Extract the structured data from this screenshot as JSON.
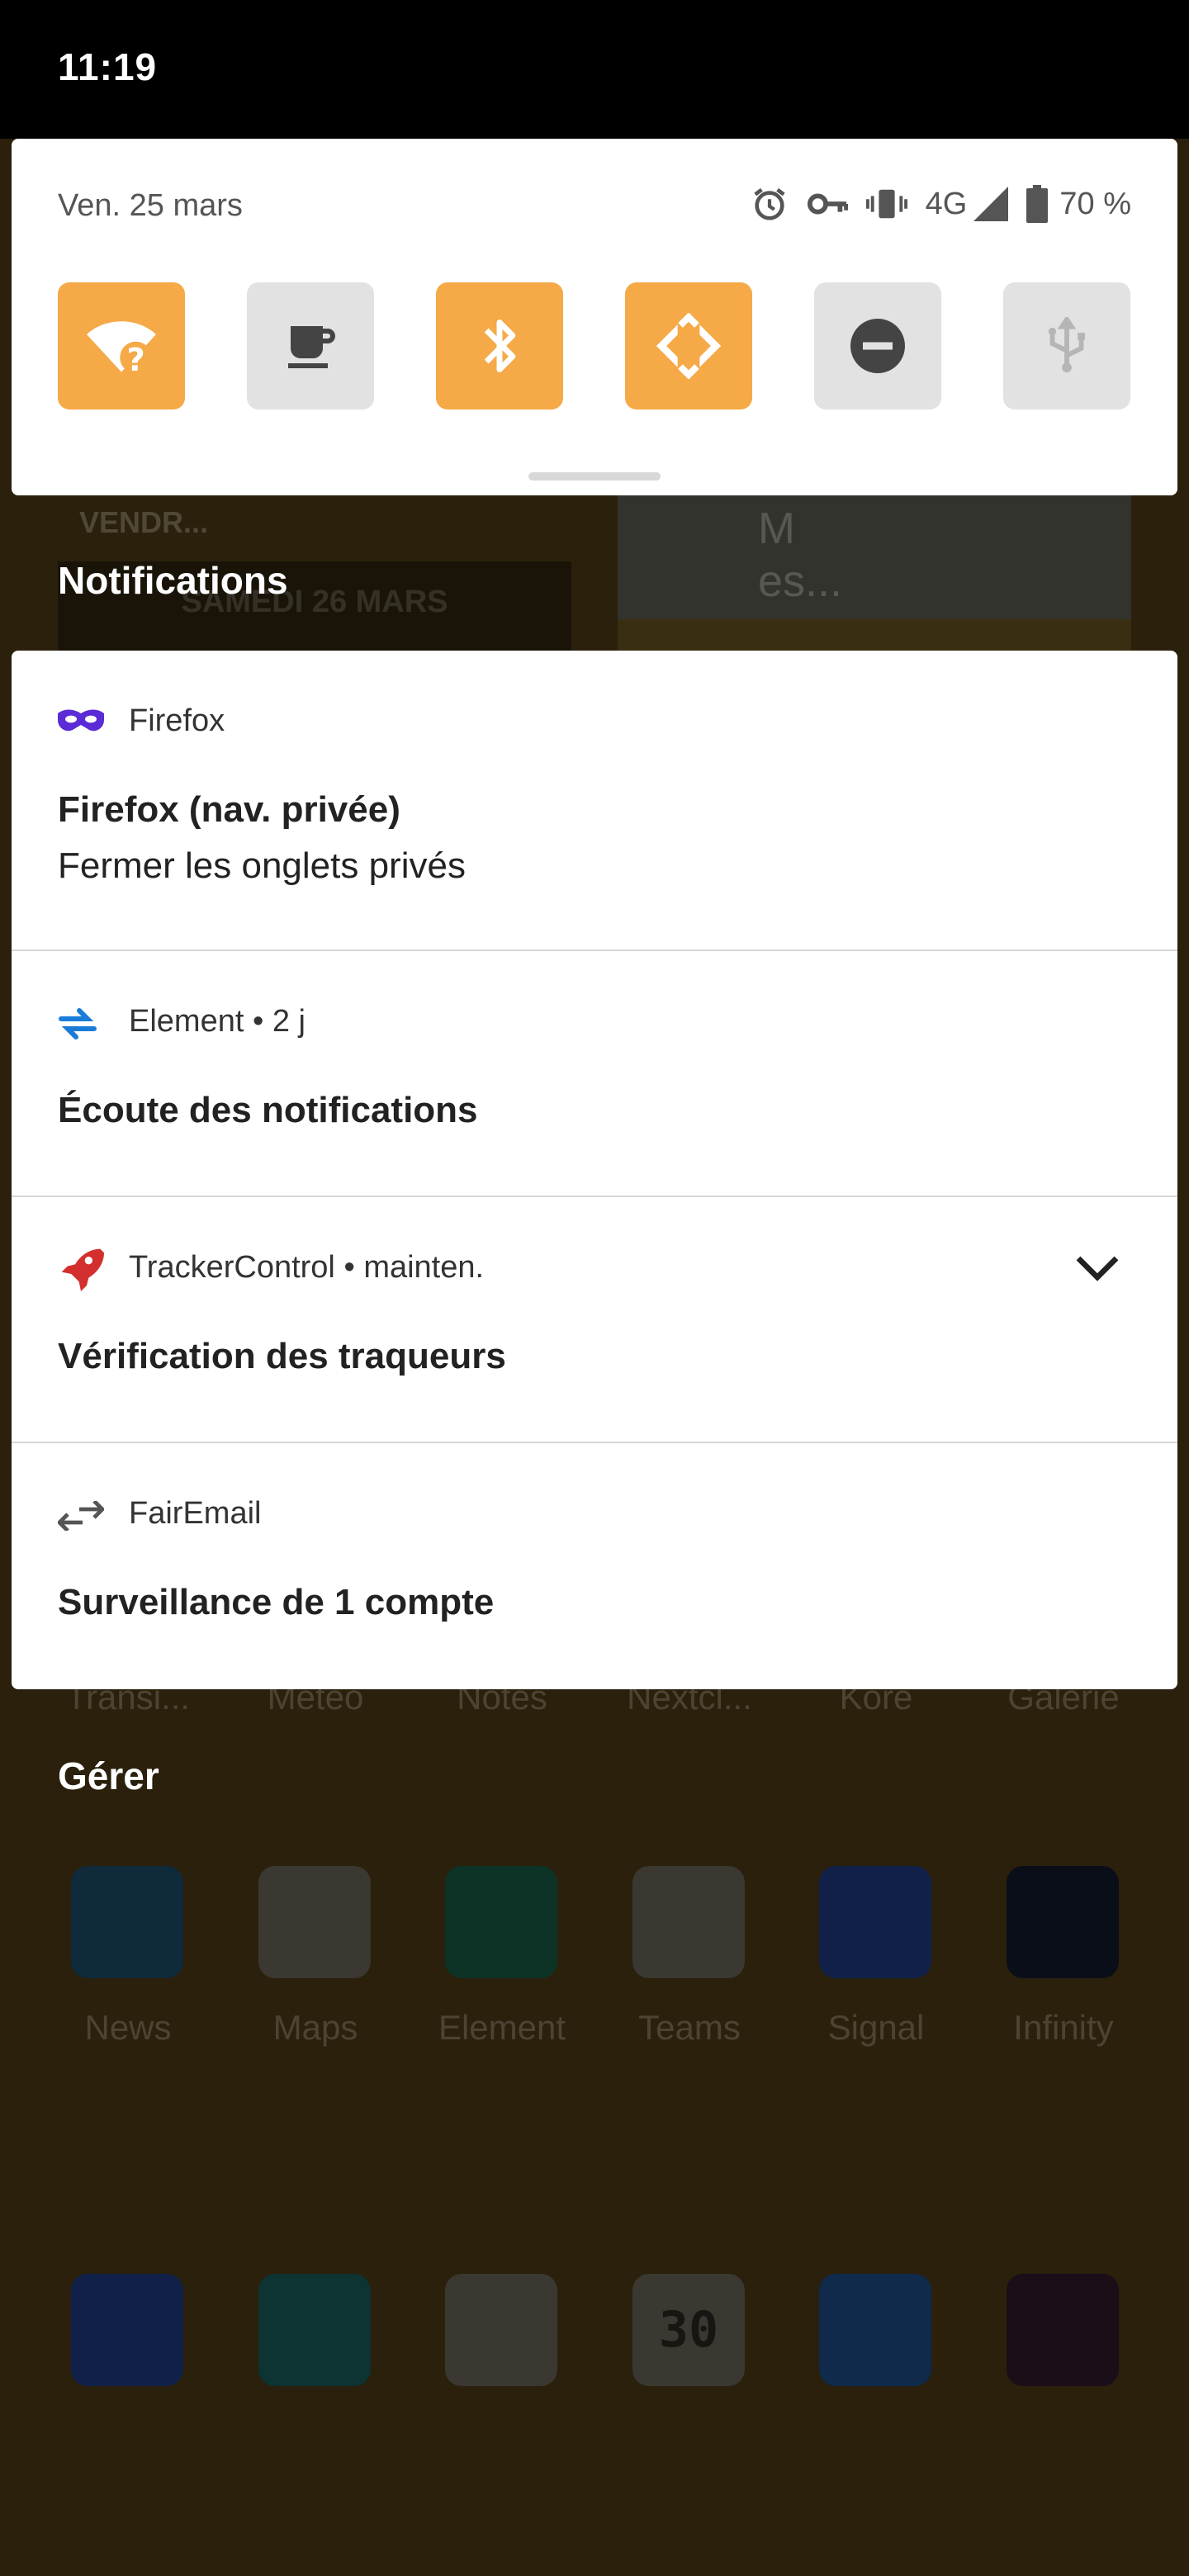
{
  "status_bar": {
    "time": "11:19"
  },
  "quick_settings": {
    "date": "Ven. 25 mars",
    "network_type": "4G",
    "battery": "70 %",
    "tiles": [
      {
        "name": "wifi-unknown",
        "state": "on"
      },
      {
        "name": "caffeine",
        "state": "off"
      },
      {
        "name": "bluetooth",
        "state": "on"
      },
      {
        "name": "auto-rotate",
        "state": "on"
      },
      {
        "name": "do-not-disturb",
        "state": "off"
      },
      {
        "name": "usb",
        "state": "off"
      }
    ]
  },
  "background": {
    "widget_left_label": "VENDR...",
    "widget_left_banner": "SAMEDI 26 MARS",
    "widget_right_title": "M es...",
    "dock_row_labels": [
      "Transi...",
      "Météo",
      "Notes",
      "Nextcl...",
      "Kore",
      "Galerie"
    ],
    "app_row": [
      "News",
      "Maps",
      "Element",
      "Teams",
      "Signal",
      "Infinity"
    ],
    "calendar_day": "30"
  },
  "notifications_heading": "Notifications",
  "notifications": [
    {
      "app": "Firefox",
      "time": "",
      "title": "Firefox (nav. privée)",
      "text": "Fermer les onglets privés"
    },
    {
      "app": "Element",
      "time": "2 j",
      "title": "Écoute des notifications",
      "text": ""
    },
    {
      "app": "TrackerControl",
      "time": "mainten.",
      "title": "Vérification des traqueurs",
      "text": ""
    },
    {
      "app": "FairEmail",
      "time": "",
      "title": "Surveillance de 1 compte",
      "text": ""
    }
  ],
  "manage_label": "Gérer",
  "colors": {
    "tile_on": "#f5a947",
    "tile_off": "#e2e2e2",
    "firefox_private": "#5b2bd6",
    "element_blue": "#1a7cd8",
    "tracker_red": "#d32f2f"
  }
}
